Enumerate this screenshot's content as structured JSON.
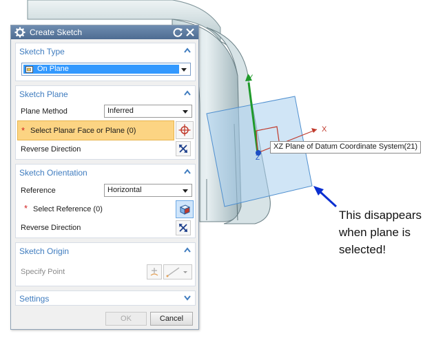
{
  "dialog": {
    "title": "Create Sketch",
    "sketch_type": {
      "header": "Sketch Type",
      "selected_value": "On Plane"
    },
    "sketch_plane": {
      "header": "Sketch Plane",
      "plane_method_label": "Plane Method",
      "plane_method_value": "Inferred",
      "select_label": "Select Planar Face or Plane (0)",
      "reverse_direction_label": "Reverse Direction"
    },
    "sketch_orientation": {
      "header": "Sketch Orientation",
      "reference_label": "Reference",
      "reference_value": "Horizontal",
      "select_label": "Select Reference (0)",
      "reverse_direction_label": "Reverse Direction"
    },
    "sketch_origin": {
      "header": "Sketch Origin",
      "specify_point_label": "Specify Point"
    },
    "settings": {
      "header": "Settings"
    },
    "ok_label": "OK",
    "cancel_label": "Cancel"
  },
  "viewport": {
    "tooltip": "XZ Plane of Datum Coordinate System(21)",
    "axis_x": "X",
    "axis_y": "Y",
    "axis_z": "Z"
  },
  "annotation": {
    "line1": "This disappears",
    "line2": "when plane is",
    "line3": "selected!"
  },
  "colors": {
    "section_header": "#3f7cbf",
    "highlight_row": "#fcd483",
    "plane_fill": "#b8d9f2",
    "annotation_arrow": "#0a2fd1"
  }
}
